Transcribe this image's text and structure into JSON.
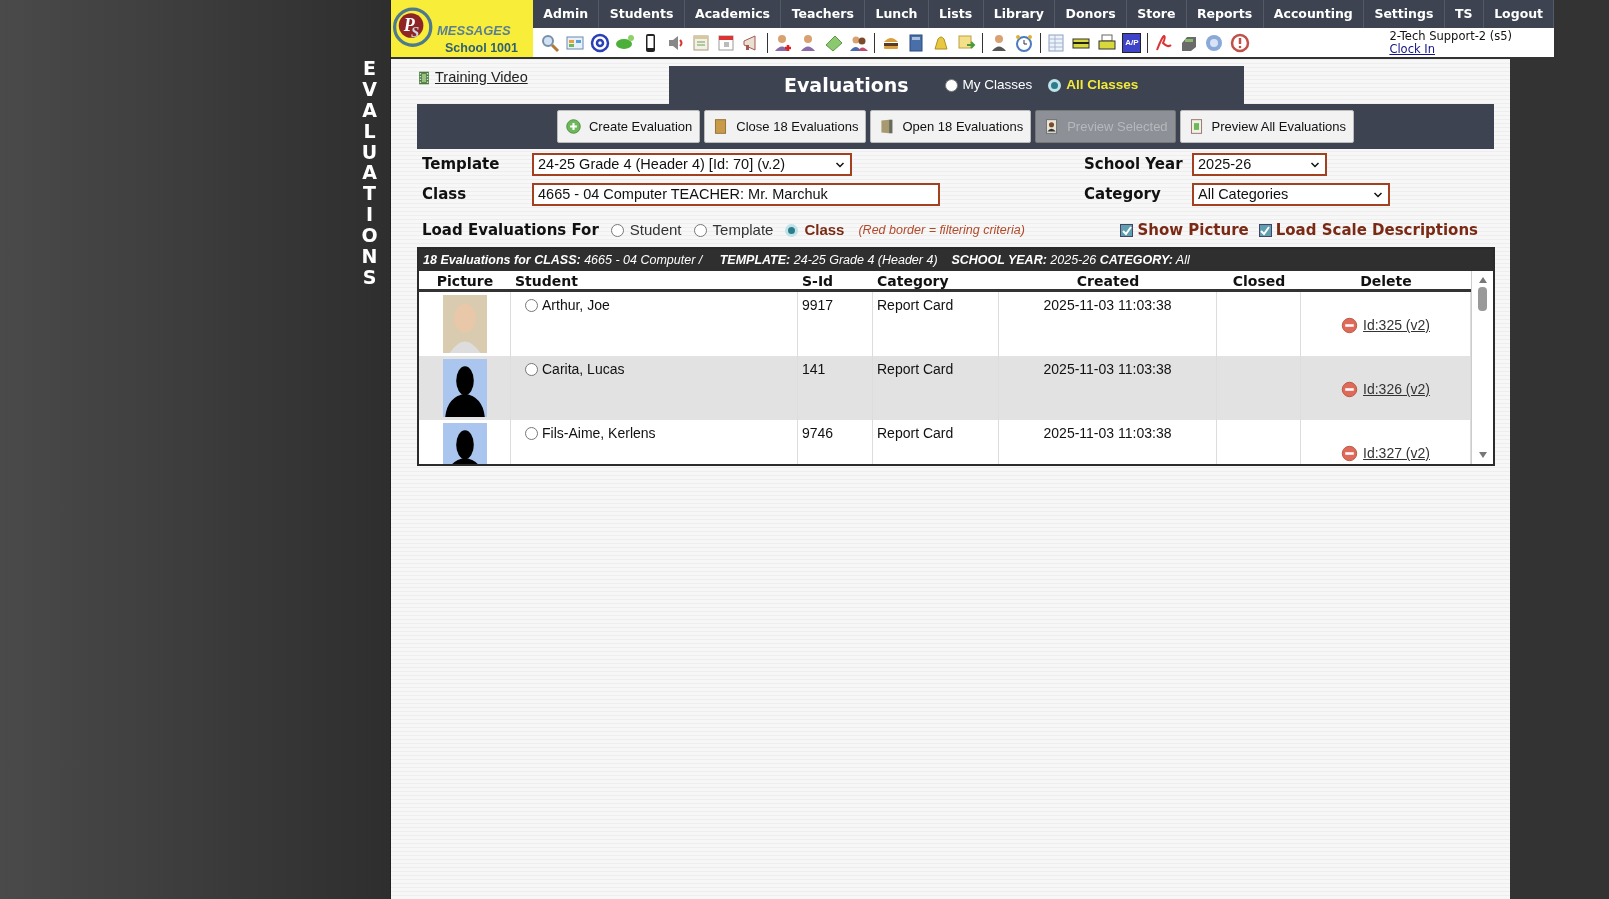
{
  "side_title": "EVALUATIONS",
  "logo": {
    "letters": [
      "P",
      "S"
    ],
    "name": "MESSAGES",
    "school": "School 1001"
  },
  "menu": [
    "Admin",
    "Students",
    "Academics",
    "Teachers",
    "Lunch",
    "Lists",
    "Library",
    "Donors",
    "Store",
    "Reports",
    "Accounting",
    "Settings",
    "TS",
    "Logout"
  ],
  "toolbar_badge": "A/P",
  "user": {
    "name": "2-Tech Support-2 (s5)",
    "link": "Clock In"
  },
  "training_link": "Training Video",
  "panel": {
    "title": "Evaluations",
    "scope_options": [
      {
        "label": "My Classes",
        "selected": false
      },
      {
        "label": "All Classes",
        "selected": true
      }
    ]
  },
  "buttons": [
    {
      "label": "Create Evaluation",
      "kind": "create",
      "disabled": false
    },
    {
      "label": "Close 18 Evaluations",
      "kind": "close",
      "disabled": false
    },
    {
      "label": "Open 18 Evaluations",
      "kind": "open",
      "disabled": false
    },
    {
      "label": "Preview Selected",
      "kind": "preview",
      "disabled": true
    },
    {
      "label": "Preview All Evaluations",
      "kind": "preview_all",
      "disabled": false
    }
  ],
  "filters": {
    "template": {
      "label": "Template",
      "value": "24-25 Grade 4 (Header 4) [Id: 70] (v.2)"
    },
    "school_year": {
      "label": "School Year",
      "value": "2025-26"
    },
    "class": {
      "label": "Class",
      "value": "4665 - 04 Computer TEACHER: Mr. Marchuk"
    },
    "category": {
      "label": "Category",
      "value": "All Categories"
    }
  },
  "load_for": {
    "label": "Load Evaluations For",
    "options": [
      {
        "label": "Student",
        "selected": false
      },
      {
        "label": "Template",
        "selected": false
      },
      {
        "label": "Class",
        "selected": true
      }
    ],
    "note": "(Red border = filtering criteria)"
  },
  "checkboxes": [
    {
      "label": "Show Picture",
      "checked": true
    },
    {
      "label": "Load Scale Descriptions",
      "checked": true
    }
  ],
  "table": {
    "caption": "**18 Evaluations for CLASS:** 4665 - 04 Computer /     **TEMPLATE:** 24-25 Grade 4 (Header 4)    **SCHOOL YEAR:** 2025-26 **CATEGORY:** All",
    "columns": [
      "Picture",
      "Student",
      "S-Id",
      "Category",
      "Created",
      "Closed",
      "Delete"
    ],
    "rows": [
      {
        "has_photo": true,
        "selected": false,
        "student": "Arthur, Joe",
        "sid": "9917",
        "category": "Report Card",
        "created": "2025-11-03 11:03:38",
        "delete_link": "Id:325 (v2)"
      },
      {
        "has_photo": false,
        "selected": false,
        "student": "Carita, Lucas",
        "sid": "141",
        "category": "Report Card",
        "created": "2025-11-03 11:03:38",
        "delete_link": "Id:326 (v2)"
      },
      {
        "has_photo": false,
        "selected": false,
        "student": "Fils-Aime, Kerlens",
        "sid": "9746",
        "category": "Report Card",
        "created": "2025-11-03 11:03:38",
        "delete_link": "Id:327 (v2)"
      }
    ]
  }
}
